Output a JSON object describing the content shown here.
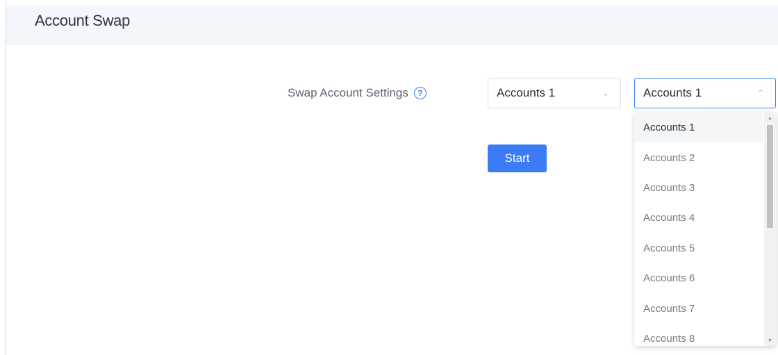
{
  "header": {
    "title": "Account Swap"
  },
  "form": {
    "label": "Swap Account Settings",
    "help_icon": "question-circle-icon",
    "select_from": {
      "value": "Accounts 1"
    },
    "select_to": {
      "value": "Accounts 1",
      "open": true
    },
    "start_label": "Start"
  },
  "dropdown": {
    "options": [
      "Accounts 1",
      "Accounts 2",
      "Accounts 3",
      "Accounts 4",
      "Accounts 5",
      "Accounts 6",
      "Accounts 7",
      "Accounts 8"
    ],
    "selected": "Accounts 1"
  },
  "colors": {
    "accent": "#3b7cf6",
    "header_bg": "#f3f6fa",
    "text": "#2b2f36",
    "muted_text": "#737b86"
  }
}
